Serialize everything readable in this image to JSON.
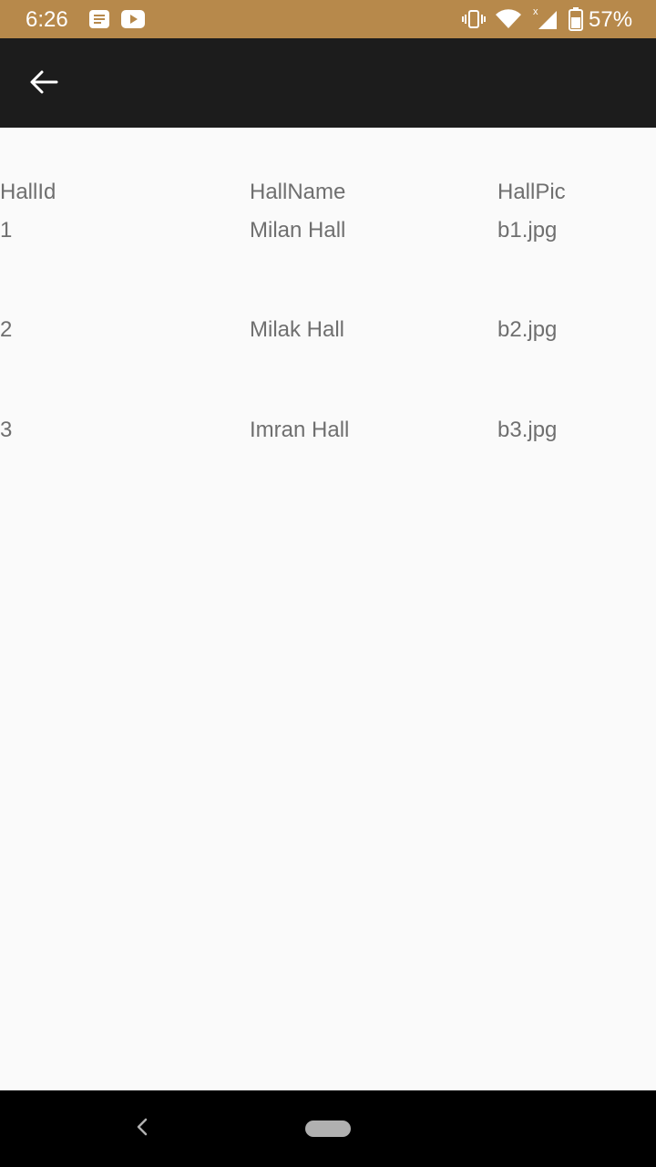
{
  "status_bar": {
    "time": "6:26",
    "battery_percent": "57%",
    "notification_icons": [
      "message-icon",
      "youtube-icon"
    ],
    "system_icons": [
      "vibrate-icon",
      "wifi-icon",
      "signal-icon",
      "battery-icon"
    ],
    "background_color": "#b7894b"
  },
  "app_bar": {
    "back_icon": "arrow-back-icon",
    "background_color": "#1c1c1c"
  },
  "table": {
    "headers": [
      "HallId",
      "HallName",
      "HallPic"
    ],
    "rows": [
      [
        "1",
        "Milan Hall",
        "b1.jpg"
      ],
      [
        "2",
        "Milak Hall",
        "b2.jpg"
      ],
      [
        "3",
        "Imran Hall",
        "b3.jpg"
      ]
    ]
  },
  "nav_bar": {
    "back_icon": "chevron-left-icon",
    "home_icon": "home-pill-icon"
  }
}
